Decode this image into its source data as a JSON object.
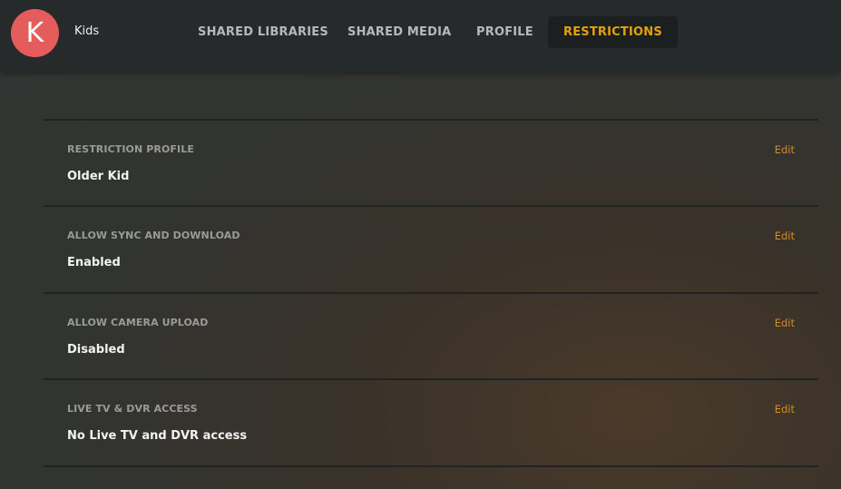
{
  "user": {
    "avatar_letter": "K",
    "name": "Kids",
    "avatar_color": "#e45c5c"
  },
  "tabs": [
    {
      "label": "SHARED LIBRARIES",
      "active": false
    },
    {
      "label": "SHARED MEDIA",
      "active": false
    },
    {
      "label": "PROFILE",
      "active": false
    },
    {
      "label": "RESTRICTIONS",
      "active": true
    }
  ],
  "sections": [
    {
      "label": "RESTRICTION PROFILE",
      "value": "Older Kid",
      "action": "Edit"
    },
    {
      "label": "ALLOW SYNC AND DOWNLOAD",
      "value": "Enabled",
      "action": "Edit"
    },
    {
      "label": "ALLOW CAMERA UPLOAD",
      "value": "Disabled",
      "action": "Edit"
    },
    {
      "label": "LIVE TV & DVR ACCESS",
      "value": "No Live TV and DVR access",
      "action": "Edit"
    }
  ],
  "colors": {
    "accent": "#e5a00d",
    "edit_link": "#d48a2f"
  }
}
